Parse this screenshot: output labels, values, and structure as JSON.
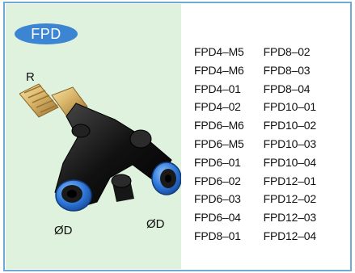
{
  "badge": {
    "label": "FPD"
  },
  "diagram_labels": {
    "r": "R",
    "d_left": "ØD",
    "d_right": "ØD"
  },
  "models": {
    "column_1": [
      "FPD4–M5",
      "FPD4–M6",
      "FPD4–01",
      "FPD4–02",
      "FPD6–M6",
      "FPD6–M5",
      "FPD6–01",
      "FPD6–02",
      "FPD6–03",
      "FPD6–04",
      "FPD8–01"
    ],
    "column_2": [
      "FPD8–02",
      "FPD8–03",
      "FPD8–04",
      "FPD10–01",
      "FPD10–02",
      "FPD10–03",
      "FPD10–04",
      "FPD12–01",
      "FPD12–02",
      "FPD12–03",
      "FPD12–04"
    ]
  },
  "colors": {
    "border": "#6fa9d6",
    "panel": "#dff2dd",
    "badge": "#3b85d2",
    "body": "#111111",
    "brass": "#d9b56a",
    "cap_blue": "#2e76d8"
  }
}
